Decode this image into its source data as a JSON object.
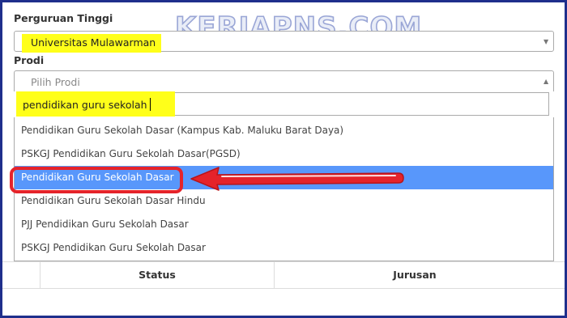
{
  "watermark": "KERJAPNS.COM",
  "form": {
    "university_label": "Perguruan Tinggi",
    "university_value": "Universitas Mulawarman",
    "prodi_label": "Prodi",
    "prodi_placeholder": "Pilih Prodi",
    "search_value": "pendidikan guru sekolah"
  },
  "options": [
    {
      "label": "Pendidikan Guru Sekolah Dasar (Kampus Kab. Maluku Barat Daya)"
    },
    {
      "label": "PSKGJ Pendidikan Guru Sekolah Dasar(PGSD)"
    },
    {
      "label": "Pendidikan Guru Sekolah Dasar",
      "selected": true
    },
    {
      "label": "Pendidikan Guru Sekolah Dasar Hindu"
    },
    {
      "label": "PJJ Pendidikan Guru Sekolah Dasar"
    },
    {
      "label": "PSKGJ Pendidikan Guru Sekolah Dasar"
    }
  ],
  "table": {
    "columns": [
      "Status",
      "Jurusan"
    ]
  },
  "colors": {
    "highlight": "#ffff1a",
    "selected_option": "#5897fb",
    "annotation": "#e5232a",
    "frame": "#1f2f8c"
  },
  "icons": {
    "university_caret": "caret-down-icon",
    "prodi_caret": "caret-up-icon",
    "annotation_arrow": "left-arrow-icon"
  }
}
